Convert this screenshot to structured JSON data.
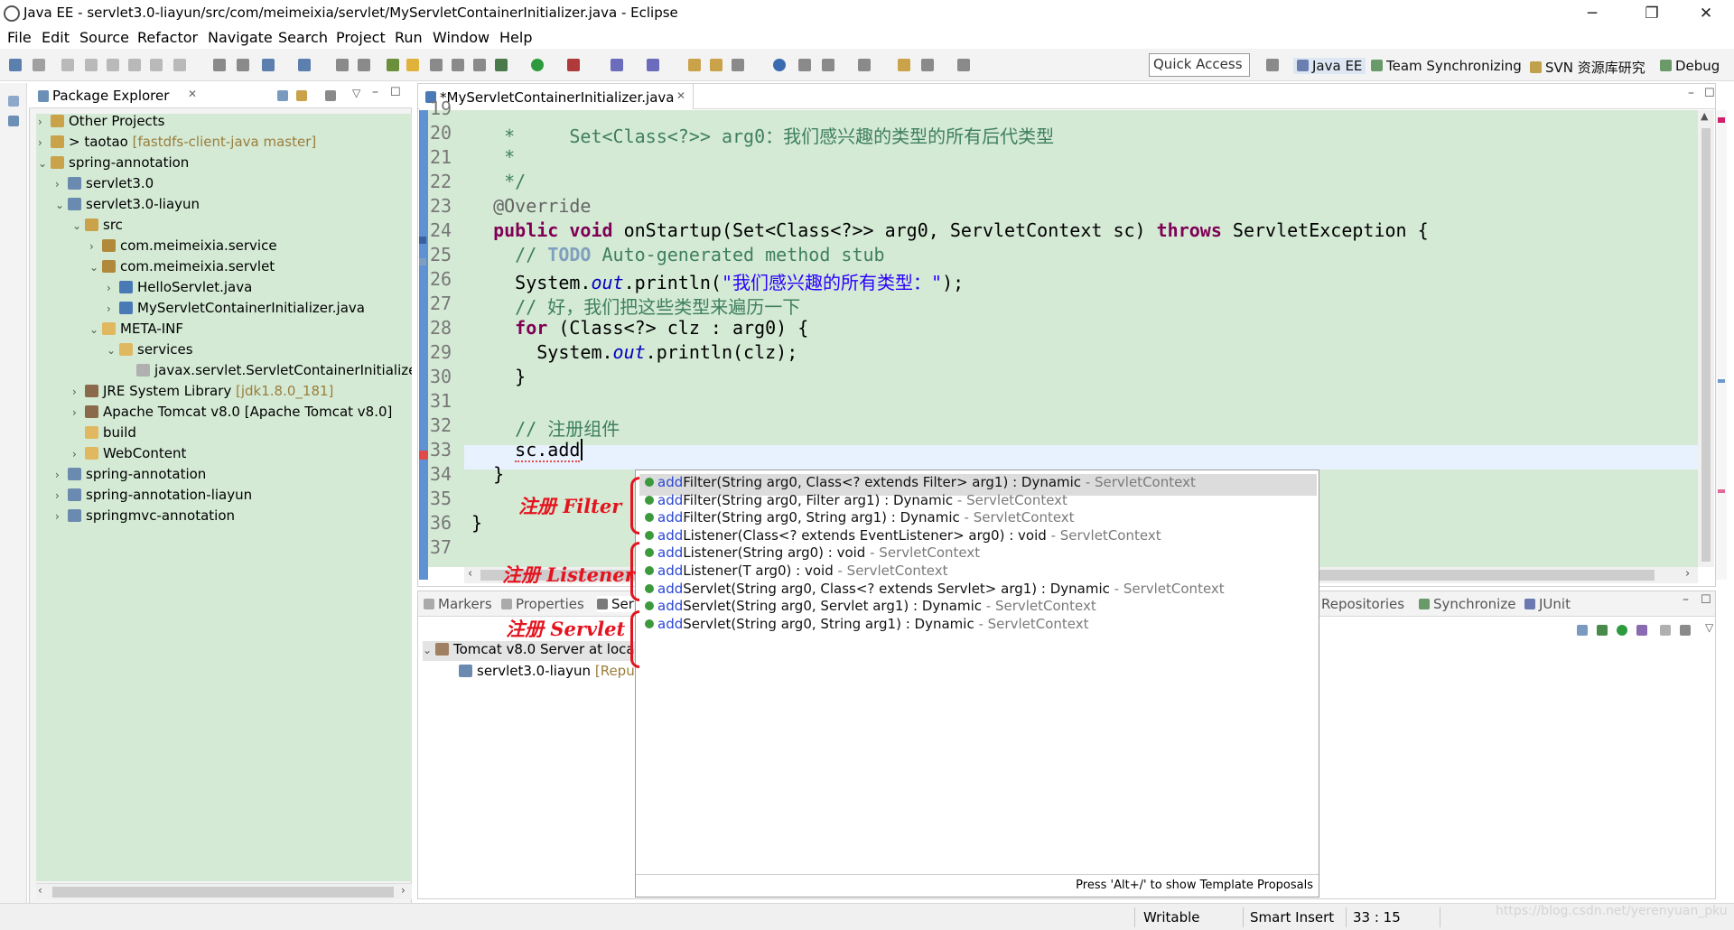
{
  "window": {
    "title": "Java EE - servlet3.0-liayun/src/com/meimeixia/servlet/MyServletContainerInitializer.java - Eclipse",
    "minimize": "─",
    "restore": "❐",
    "close": "✕"
  },
  "menu": [
    "File",
    "Edit",
    "Source",
    "Refactor",
    "Navigate",
    "Search",
    "Project",
    "Run",
    "Window",
    "Help"
  ],
  "toolbar": {
    "quick_access": "Quick Access",
    "perspectives": [
      "Java EE",
      "Team Synchronizing",
      "SVN 资源库研究",
      "Debug"
    ]
  },
  "package_explorer": {
    "title": "Package Explorer",
    "tree": [
      {
        "label": "Other Projects",
        "decor": "",
        "depth": 0,
        "expanded": false,
        "icon": "working-set-icon"
      },
      {
        "label": "> taotao",
        "decor": "[fastdfs-client-java master]",
        "depth": 0,
        "expanded": false,
        "icon": "git-project-icon"
      },
      {
        "label": "spring-annotation",
        "decor": "",
        "depth": 0,
        "expanded": true,
        "icon": "working-set-icon"
      },
      {
        "label": "servlet3.0",
        "decor": "",
        "depth": 1,
        "expanded": false,
        "icon": "web-project-icon"
      },
      {
        "label": "servlet3.0-liayun",
        "decor": "",
        "depth": 1,
        "expanded": true,
        "icon": "web-project-icon"
      },
      {
        "label": "src",
        "decor": "",
        "depth": 2,
        "expanded": true,
        "icon": "source-folder-icon"
      },
      {
        "label": "com.meimeixia.service",
        "decor": "",
        "depth": 3,
        "expanded": false,
        "icon": "package-icon"
      },
      {
        "label": "com.meimeixia.servlet",
        "decor": "",
        "depth": 3,
        "expanded": true,
        "icon": "package-icon"
      },
      {
        "label": "HelloServlet.java",
        "decor": "",
        "depth": 4,
        "expanded": false,
        "icon": "java-file-icon"
      },
      {
        "label": "MyServletContainerInitializer.java",
        "decor": "",
        "depth": 4,
        "expanded": false,
        "icon": "java-file-icon"
      },
      {
        "label": "META-INF",
        "decor": "",
        "depth": 3,
        "expanded": true,
        "icon": "folder-icon"
      },
      {
        "label": "services",
        "decor": "",
        "depth": 4,
        "expanded": true,
        "icon": "folder-icon"
      },
      {
        "label": "javax.servlet.ServletContainerInitializer",
        "decor": "",
        "depth": 5,
        "expanded": null,
        "icon": "text-file-icon"
      },
      {
        "label": "JRE System Library",
        "decor": "[jdk1.8.0_181]",
        "depth": 2,
        "expanded": false,
        "icon": "library-icon"
      },
      {
        "label": "Apache Tomcat v8.0 [Apache Tomcat v8.0]",
        "decor": "",
        "depth": 2,
        "expanded": false,
        "icon": "library-icon"
      },
      {
        "label": "build",
        "decor": "",
        "depth": 2,
        "expanded": null,
        "icon": "folder-icon"
      },
      {
        "label": "WebContent",
        "decor": "",
        "depth": 2,
        "expanded": false,
        "icon": "folder-icon"
      },
      {
        "label": "spring-annotation",
        "decor": "",
        "depth": 1,
        "expanded": false,
        "icon": "web-project-icon"
      },
      {
        "label": "spring-annotation-liayun",
        "decor": "",
        "depth": 1,
        "expanded": false,
        "icon": "web-project-icon"
      },
      {
        "label": "springmvc-annotation",
        "decor": "",
        "depth": 1,
        "expanded": false,
        "icon": "web-project-icon"
      }
    ]
  },
  "editor": {
    "tab_label": "*MyServletContainerInitializer.java",
    "line_numbers": [
      "19",
      "20",
      "21",
      "22",
      "23",
      "24",
      "25",
      "26",
      "27",
      "28",
      "29",
      "30",
      "31",
      "32",
      "33",
      "34",
      "35",
      "36",
      "37"
    ],
    "code": {
      "l20_star": "*     ",
      "l20_text": "Set<Class<?>> arg0：我们感兴趣的类型的所有后代类型",
      "l21": "*",
      "l22": "*/",
      "l23": "@Override",
      "l24_kw1": "public",
      "l24_kw2": "void",
      "l24_a": " onStartup(Set<Class<?>> arg0, ServletContext sc) ",
      "l24_kw3": "throws",
      "l24_b": " ServletException {",
      "l25_a": "// ",
      "l25_todo": "TODO",
      "l25_b": " Auto-generated method stub",
      "l26_a": "System.",
      "l26_out": "out",
      "l26_b": ".println(",
      "l26_str": "\"我们感兴趣的所有类型：\"",
      "l26_c": ");",
      "l27": "// 好，我们把这些类型来遍历一下",
      "l28_kw": "for",
      "l28_rest": " (Class<?> clz : arg0) {",
      "l29_a": "System.",
      "l29_out": "out",
      "l29_b": ".println(clz);",
      "l30": "}",
      "l32": "// 注册组件",
      "l33": "sc.add",
      "l34": "}",
      "l36": "}"
    }
  },
  "completion": {
    "items": [
      {
        "m": "add",
        "rest": "Filter(String arg0, Class<? extends Filter> arg1) : Dynamic",
        "owner": " - ServletContext",
        "selected": true
      },
      {
        "m": "add",
        "rest": "Filter(String arg0, Filter arg1) : Dynamic",
        "owner": " - ServletContext",
        "selected": false
      },
      {
        "m": "add",
        "rest": "Filter(String arg0, String arg1) : Dynamic",
        "owner": " - ServletContext",
        "selected": false
      },
      {
        "m": "add",
        "rest": "Listener(Class<? extends EventListener> arg0) : void",
        "owner": " - ServletContext",
        "selected": false
      },
      {
        "m": "add",
        "rest": "Listener(String arg0) : void",
        "owner": " - ServletContext",
        "selected": false
      },
      {
        "m": "add",
        "rest": "Listener(T arg0) : void",
        "owner": " - ServletContext",
        "selected": false
      },
      {
        "m": "add",
        "rest": "Servlet(String arg0, Class<? extends Servlet> arg1) : Dynamic",
        "owner": " - ServletContext",
        "selected": false
      },
      {
        "m": "add",
        "rest": "Servlet(String arg0, Servlet arg1) : Dynamic",
        "owner": " - ServletContext",
        "selected": false
      },
      {
        "m": "add",
        "rest": "Servlet(String arg0, String arg1) : Dynamic",
        "owner": " - ServletContext",
        "selected": false
      }
    ],
    "footer": "Press 'Alt+/' to show Template Proposals"
  },
  "annotations": [
    "注册 Filter",
    "注册 Listener",
    "注册 Servlet"
  ],
  "bottom_panel": {
    "tabs": [
      "Markers",
      "Properties",
      "Ser",
      "Repositories",
      "Synchronize",
      "JUnit"
    ],
    "servers": [
      {
        "label": "Tomcat v8.0 Server at loca"
      },
      {
        "label": "servlet3.0-liayun",
        "decor": "[Repub"
      }
    ]
  },
  "status": {
    "writable": "Writable",
    "insert_mode": "Smart Insert",
    "position": "33 : 15",
    "watermark": "https://blog.csdn.net/yerenyuan_pku"
  },
  "colors": {
    "editor_bg": "#d4ead5",
    "keyword": "#7f0055",
    "comment": "#3f7f5f",
    "string": "#2a00ff",
    "annotation_red": "#e4141f"
  }
}
